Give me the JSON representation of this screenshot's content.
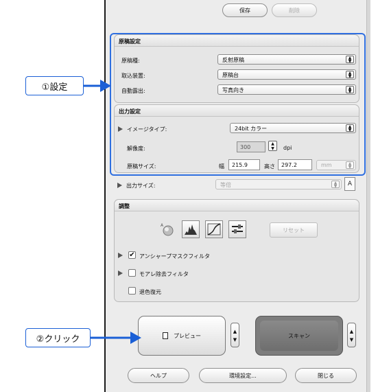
{
  "top_buttons": {
    "save": "保存",
    "delete": "削除"
  },
  "original_settings": {
    "title": "原稿設定",
    "rows": [
      {
        "label": "原稿種:",
        "value": "反射原稿"
      },
      {
        "label": "取込装置:",
        "value": "原稿台"
      },
      {
        "label": "自動露出:",
        "value": "写真向き"
      }
    ]
  },
  "output_settings": {
    "title": "出力設定",
    "image_type_label": "イメージタイプ:",
    "image_type_value": "24bit カラー",
    "resolution_label": "解像度:",
    "resolution_value": "300",
    "resolution_unit": "dpi",
    "doc_size_label": "原稿サイズ:",
    "width_label": "幅",
    "width_value": "215.9",
    "height_label": "高さ",
    "height_value": "297.2",
    "unit_value": "mm"
  },
  "output_size": {
    "label": "出力サイズ:",
    "value": "等倍"
  },
  "adjust": {
    "title": "調整",
    "reset_label": "リセット",
    "unsharp_label": "アンシャープマスクフィルタ",
    "unsharp_checked": true,
    "moire_label": "モアレ除去フィルタ",
    "moire_checked": false,
    "color_restore_label": "退色復元",
    "color_restore_checked": false
  },
  "actions": {
    "preview": "プレビュー",
    "scan": "スキャン"
  },
  "bottom_buttons": {
    "help": "ヘルプ",
    "prefs": "環境設定...",
    "close": "閉じる"
  },
  "callouts": {
    "settings": "①設定",
    "click": "②クリック"
  },
  "colors": {
    "callout_blue": "#1a5fd6",
    "scan_button": "#7d7d7d"
  }
}
